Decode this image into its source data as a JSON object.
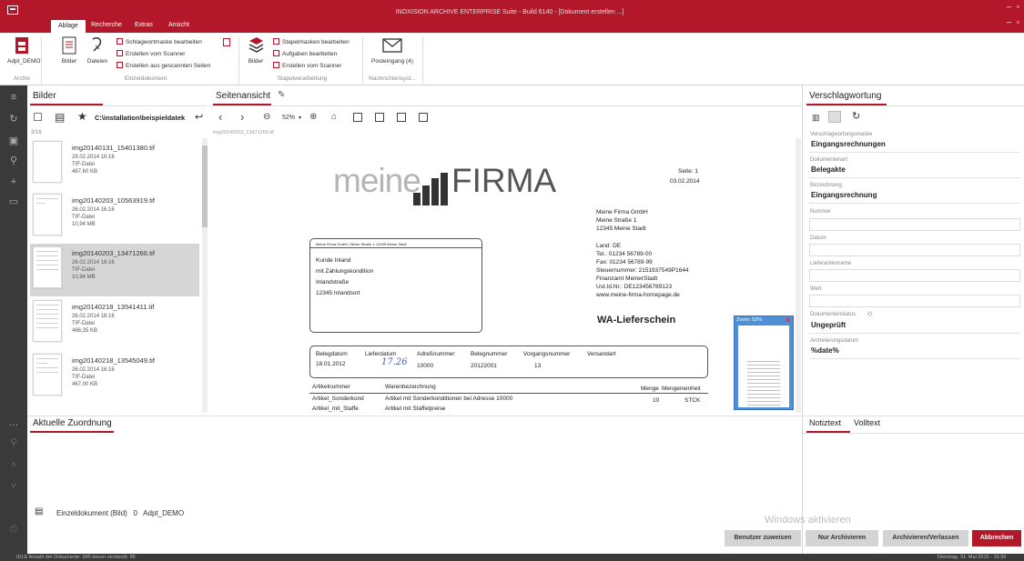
{
  "window": {
    "title": "INOXISION ARCHIVE ENTERPRISE Suite - Build 6140 - [Dokument erstellen ...]",
    "minimize": "–",
    "maximize": "▫"
  },
  "ribbon_tabs": [
    "Ablage",
    "Recherche",
    "Extras",
    "Ansicht"
  ],
  "ribbon": {
    "archiv_btn": "Adpt_DEMO",
    "archiv_group": "Archiv",
    "bilder_btn": "Bilder",
    "dateien_btn": "Dateien",
    "einzel_items": [
      "Schlagwortmaske bearbeiten",
      "Erstellen vom Scanner",
      "Erstellen aus gescannten Seiten"
    ],
    "einzel_group": "Einzeldokument",
    "stapel_bilder": "Bilder",
    "stapel_items": [
      "Stapelmasken bearbeiten",
      "Aufgaben bearbeiten",
      "Erstellen vom Scanner"
    ],
    "stapel_group": "Stapelverarbeitung",
    "posteingang_btn": "Posteingang (4)",
    "nachricht_group": "Nachrichtensyst..."
  },
  "bilder_panel": {
    "title": "Bilder",
    "path": "C:\\installation\\beispieldatek",
    "count": "3/16",
    "files": [
      {
        "name": "img20140131_15401380.tif",
        "date": "28.02.2014 16:16",
        "type": "TIF-Datei",
        "size": "467,60 KB"
      },
      {
        "name": "img20140203_10563919.tif",
        "date": "26.02.2014 16:16",
        "type": "TIF-Datei",
        "size": "10,94 MB"
      },
      {
        "name": "img20140203_13471266.tif",
        "date": "26.02.2014 16:16",
        "type": "TIF-Datei",
        "size": "10,94 MB"
      },
      {
        "name": "img20140218_13541411.tif",
        "date": "26.02.2014 16:16",
        "type": "TIF-Datei",
        "size": "466,35 KB"
      },
      {
        "name": "img20140218_13545049.tif",
        "date": "26.02.2014 16:16",
        "type": "TIF-Datei",
        "size": "467,00 KB"
      }
    ]
  },
  "seitenansicht": {
    "title": "Seitenansicht",
    "zoom": "52%",
    "filename": "img20140203_13471266.tif",
    "zoom_preview": "Zoom: 52%"
  },
  "document": {
    "logo_a": "meine",
    "logo_b": "FIRMA",
    "seite": "Seite: 1",
    "date": "03.02.2014",
    "sender": [
      "Meine Firma GmbH",
      "Meine Straße 1",
      "12345 Meine Stadt"
    ],
    "contact": [
      "Land: DE",
      "Tel.: 01234 56789-00",
      "Fax: 01234 56789-99",
      "Steuernummer: 2151937549P1644",
      "Finanzamt MeinerStadt",
      "Ust.Id.Nr.: DE123456789123",
      "www.meine-firma-homepage.de"
    ],
    "address_header": "Meine Firma GmbH- Meine Straße 1-12345 Meine Stadt",
    "address": [
      "Kunde Inland",
      "mit Zahlungskondition",
      "Inlandstraße",
      "12345 Inlandsort"
    ],
    "doc_title": "WA-Lieferschein",
    "info_headers": [
      "Belegdatum",
      "Lieferdatum",
      "Adreßnummer",
      "Belegnummer",
      "Vorgangsnummer",
      "Versandart"
    ],
    "info_values": [
      "18.01.2012",
      "17.26",
      "10000",
      "20122001",
      "13",
      ""
    ],
    "table_headers": [
      "Artikelnummer",
      "Warenbezeichnung",
      "Menge",
      "Mengeneinheit"
    ],
    "rows": [
      {
        "art": "Artikel_Sonderkond",
        "desc": "Artikel mit Sonderkonditionen bei Adresse 10000",
        "menge": "10",
        "einheit": "STCK"
      },
      {
        "art": "Artikel_mit_Staffe",
        "desc": "Artikel mit Staffelpreise",
        "menge": "",
        "einheit": ""
      }
    ]
  },
  "zuordnung": {
    "title": "Aktuelle Zuordnung",
    "entry": "Einzeldokument (Bild)   0   Adpt_DEMO"
  },
  "verschlagwortung": {
    "title": "Verschlagwortung",
    "fields": [
      {
        "label": "Verschlagwortungsmaske",
        "value": "Eingangsrechnungen"
      },
      {
        "label": "Dokumentenart",
        "value": "Belegakte"
      },
      {
        "label": "Bezeichnung",
        "value": "Eingangsrechnung"
      },
      {
        "label": "Nummer",
        "value": ""
      },
      {
        "label": "Datum",
        "value": ""
      },
      {
        "label": "Lieferantenname",
        "value": ""
      },
      {
        "label": "Wert",
        "value": ""
      },
      {
        "label": "Dokumentenstatus",
        "value": "Ungeprüft"
      },
      {
        "label": "Archivierungsdatum",
        "value": "%date%"
      }
    ]
  },
  "notiz_tabs": [
    "Notiztext",
    "Volltext"
  ],
  "watermark": "Windows aktivieren",
  "buttons": {
    "assign": "Benutzer zuweisen",
    "archive": "Nur Archivieren",
    "archive_leave": "Archivieren/Verlassen",
    "cancel": "Abbrechen"
  },
  "status": {
    "left": "IDLE   Anzahl der Dokumente: 345 davon versteckt: 85",
    "right": "Dienstag, 31. Mai 2016 - 15:39"
  }
}
